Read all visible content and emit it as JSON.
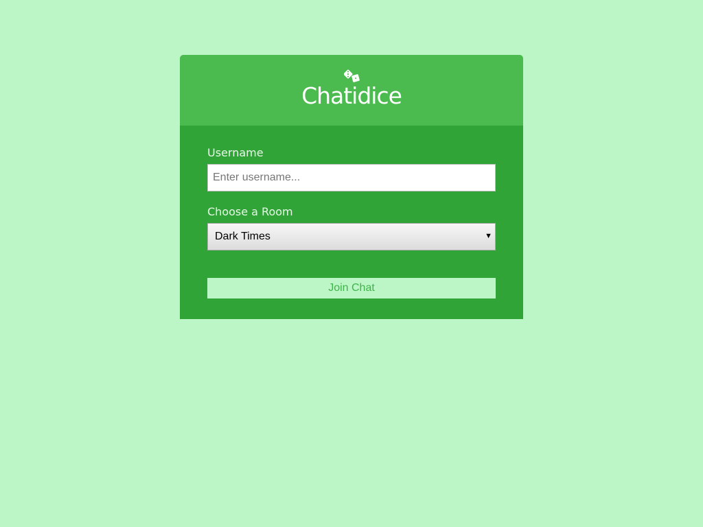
{
  "header": {
    "logo_icon": "dice-icon",
    "title": "Chatidice"
  },
  "form": {
    "username_label": "Username",
    "username_placeholder": "Enter username...",
    "username_value": "",
    "room_label": "Choose a Room",
    "room_selected": "Dark Times",
    "join_label": "Join Chat"
  },
  "colors": {
    "page_background": "#bcf5c6",
    "header_background": "#4bbb4f",
    "body_background": "#30a437",
    "button_text": "#40b44a"
  }
}
